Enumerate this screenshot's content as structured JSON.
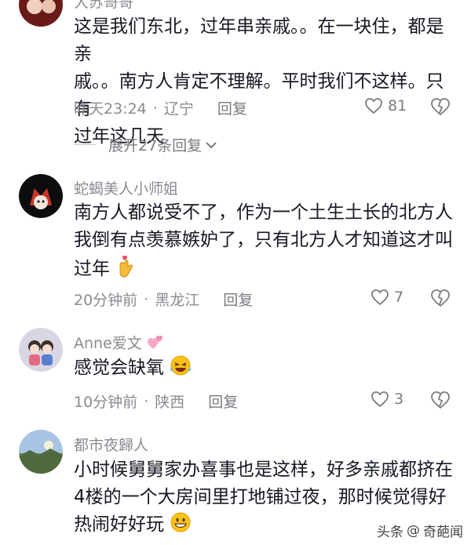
{
  "comments": [
    {
      "username": "大苏哥哥",
      "text_lines": [
        "这是我们东北，过年串亲戚。。在一块住，都是亲",
        "戚。。南方人肯定不理解。平时我们不这样。只有",
        "过年这几天"
      ],
      "time": "昨天23:24",
      "location": "辽宁",
      "reply_label": "回复",
      "likes": "81"
    },
    {
      "username": "蛇蝎美人小师姐",
      "text_lines": [
        "南方人都说受不了，作为一个土生土长的北方人",
        "我倒有点羡慕嫉妒了，只有北方人才知道这才叫",
        "过年"
      ],
      "time": "20分钟前",
      "location": "黑龙江",
      "reply_label": "回复",
      "likes": "7"
    },
    {
      "username": "Anne爱文",
      "text_lines": [
        "感觉会缺氧"
      ],
      "time": "10分钟前",
      "location": "陕西",
      "reply_label": "回复",
      "likes": "3"
    },
    {
      "username": "都市夜歸人",
      "text_lines": [
        "小时候舅舅家办喜事也是这样，好多亲戚都挤在",
        "4楼的一个大房间里打地铺过夜，那时候觉得好",
        "热闹好好玩"
      ]
    }
  ],
  "expand_replies": "展开27条回复",
  "watermark": {
    "brand": "头条",
    "at": "@",
    "author": "奇葩闻"
  },
  "colors": {
    "text": "#161823",
    "meta": "#8a8b91",
    "reply": "#7a7b80"
  },
  "icons": [
    "heart-icon",
    "dislike-heart-icon",
    "chevron-down-icon",
    "heart-hands-emoji",
    "laughing-tears-emoji",
    "grinning-emoji"
  ]
}
